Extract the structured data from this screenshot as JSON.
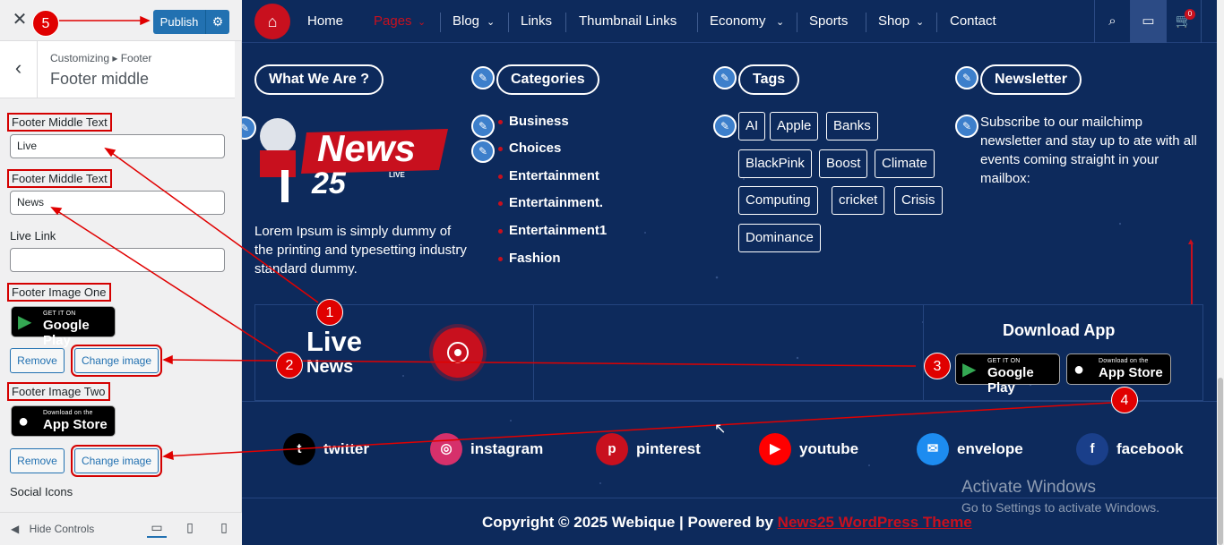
{
  "customizer": {
    "close_icon": "close-icon",
    "publish_label": "Publish",
    "gear_icon": "gear-icon",
    "breadcrumb": "Customizing ▸ Footer",
    "section_title": "Footer middle",
    "fields": {
      "text1_label": "Footer Middle Text",
      "text1_value": "Live",
      "text2_label": "Footer Middle Text",
      "text2_value": "News",
      "live_link_label": "Live Link",
      "live_link_value": "",
      "image1_label": "Footer Image One",
      "image1_store_small": "GET IT ON",
      "image1_store_big": "Google Play",
      "image2_label": "Footer Image Two",
      "image2_store_small": "Download on the",
      "image2_store_big": "App Store",
      "remove_label": "Remove",
      "change_image_label": "Change image",
      "social_icons_label": "Social Icons"
    },
    "footer_bar": {
      "hide_controls": "Hide Controls"
    }
  },
  "preview": {
    "nav": {
      "items": [
        "Home",
        "Pages",
        "Blog",
        "Links",
        "Thumbnail Links",
        "Economy",
        "Sports",
        "Shop",
        "Contact"
      ],
      "active": "Pages",
      "cart_count": "0"
    },
    "widgets": {
      "what_we_are": "What We Are ?",
      "categories_title": "Categories",
      "tags_title": "Tags",
      "newsletter_title": "Newsletter",
      "logo_word1": "News",
      "logo_word2": "25",
      "logo_live": "LIVE",
      "about_text": "Lorem Ipsum is simply dummy of the printing and typesetting industry standard dummy.",
      "categories": [
        "Business",
        "Choices",
        "Entertainment",
        "Entertainment.",
        "Entertainment1",
        "Fashion"
      ],
      "tags": [
        "AI",
        "Apple",
        "Banks",
        "BlackPink",
        "Boost",
        "Climate",
        "Computing",
        "cricket",
        "Crisis",
        "Dominance"
      ],
      "newsletter_text": "Subscribe to our mailchimp newsletter and stay up to ate with all events coming straight in your mailbox:"
    },
    "middle": {
      "live": "Live",
      "news": "News",
      "download_app": "Download App",
      "gp_small": "GET IT ON",
      "gp_big": "Google Play",
      "as_small": "Download on the",
      "as_big": "App Store"
    },
    "socials": [
      "twitter",
      "instagram",
      "pinterest",
      "youtube",
      "envelope",
      "facebook"
    ],
    "copyright_prefix": "Copyright © 2025 Webique | Powered by",
    "copyright_link": "News25 WordPress Theme",
    "watermark_title": "Activate Windows",
    "watermark_sub": "Go to Settings to activate Windows."
  },
  "annotations": [
    "1",
    "2",
    "3",
    "4",
    "5"
  ],
  "colors": {
    "brand_red": "#c8101e",
    "footer_bg": "#0d2a5c",
    "wp_blue": "#2271b1",
    "annotation_red": "#e00000"
  }
}
